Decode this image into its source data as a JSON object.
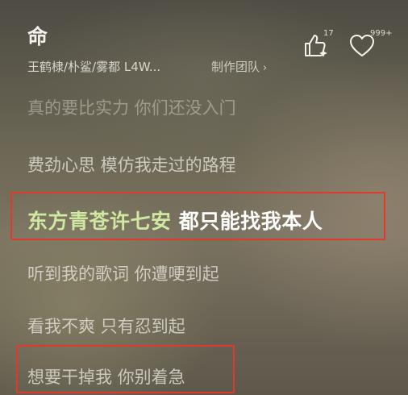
{
  "song": {
    "title": "命",
    "artists": "王鹤棣/朴鲨/雾都 L4W...",
    "credits_label": "制作团队",
    "credits_chevron": "›"
  },
  "actions": {
    "like_count": "17",
    "favorite_count": "999+"
  },
  "lyrics": [
    "真的要比实力 你们还没入门",
    "费劲心思 模仿我走过的路程",
    {
      "highlight": "东方青苍许七安",
      "rest": " 都只能找我本人"
    },
    "听到我的歌词 你遭哽到起",
    "看我不爽 只有忍到起",
    "想要干掉我 你别着急"
  ],
  "colors": {
    "annotation_box": "#e03a2e",
    "current_lyric_highlight": "#cfe8a2"
  }
}
